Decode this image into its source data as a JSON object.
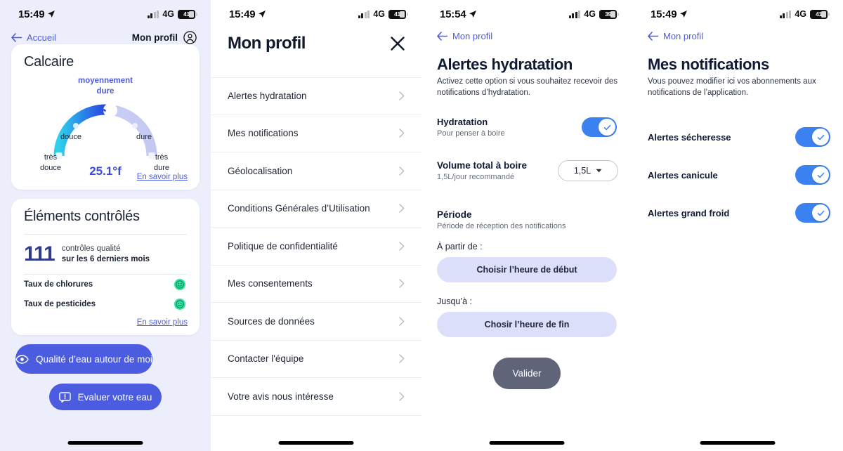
{
  "panel1": {
    "status": {
      "time": "15:49",
      "network": "4G",
      "battery": "41"
    },
    "nav": {
      "back_label": "Accueil",
      "profile_label": "Mon profil"
    },
    "calcaire_card": {
      "title": "Calcaire",
      "learn_more": "En savoir plus",
      "gauge": {
        "headline": "moyennement\ndure",
        "headline_line1": "moyennement",
        "headline_line2": "dure",
        "value": "25.1°f",
        "label_left_mid": "douce",
        "label_right_mid": "dure",
        "label_left_end_1": "très",
        "label_left_end_2": "douce",
        "label_right_end_1": "très",
        "label_right_end_2": "dure"
      }
    },
    "elements_card": {
      "title": "Éléments contrôlés",
      "count": "111",
      "count_desc_line1": "contrôles qualité",
      "count_desc_line2": "sur les 6 derniers mois",
      "rows": [
        {
          "label": "Taux de chlorures",
          "status": "good"
        },
        {
          "label": "Taux de pesticides",
          "status": "good"
        }
      ],
      "learn_more": "En savoir plus"
    },
    "buttons": {
      "quality": "Qualité d’eau autour de moi",
      "evaluate": "Evaluer votre eau"
    }
  },
  "panel2": {
    "status": {
      "time": "15:49",
      "network": "4G",
      "battery": "41"
    },
    "title": "Mon profil",
    "menu_items": [
      "Alertes hydratation",
      "Mes notifications",
      "Géolocalisation",
      "Conditions Générales d’Utilisation",
      "Politique de confidentialité",
      "Mes consentements",
      "Sources de données",
      "Contacter l'équipe",
      "Votre avis nous intéresse"
    ]
  },
  "panel3": {
    "status": {
      "time": "15:54",
      "network": "4G",
      "battery": "39"
    },
    "nav_back": "Mon profil",
    "title": "Alertes hydratation",
    "subtitle": "Activez cette option si vous souhaitez recevoir des notifications d’hydratation.",
    "hydration": {
      "name": "Hydratation",
      "desc": "Pour penser à boire",
      "toggle_on": true
    },
    "volume": {
      "name": "Volume total à boire",
      "desc": "1,5L/jour recommandé",
      "selected": "1,5L"
    },
    "period": {
      "title": "Période",
      "desc": "Période de réception des notifications",
      "from_label": "À partir de :",
      "from_button": "Choisir l’heure de début",
      "to_label": "Jusqu’à :",
      "to_button": "Chosir l’heure de fin"
    },
    "validate": "Valider"
  },
  "panel4": {
    "status": {
      "time": "15:49",
      "network": "4G",
      "battery": "41"
    },
    "nav_back": "Mon profil",
    "title": "Mes notifications",
    "subtitle": "Vous pouvez modifier ici vos abonnements aux notifications de l’application.",
    "notifications": [
      {
        "label": "Alertes sécheresse",
        "toggle_on": true
      },
      {
        "label": "Alertes canicule",
        "toggle_on": true
      },
      {
        "label": "Alertes grand froid",
        "toggle_on": true
      }
    ]
  },
  "colors": {
    "accent_blue": "#4c5ce0",
    "toggle_blue": "#3b82f0",
    "gauge_cyan": "#2fd0ee",
    "gauge_blue": "#2a4fe0",
    "gauge_lavender": "#c5c9f2",
    "smiley_green": "#2fe3a0",
    "panel1_bg": "#eceffb",
    "time_btn_bg": "#dcdffa",
    "valider_bg": "#5f6478"
  }
}
